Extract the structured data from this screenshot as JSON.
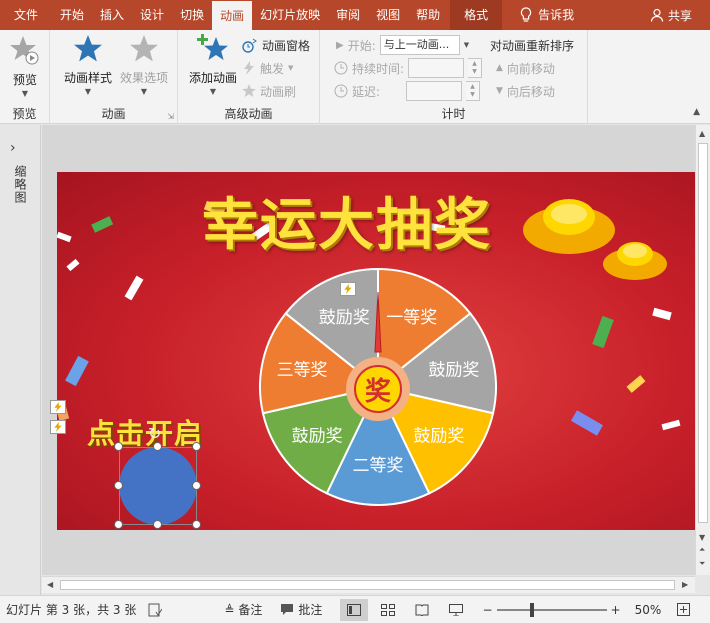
{
  "tabs": [
    {
      "label": "文件",
      "active": false
    },
    {
      "label": "开始",
      "active": false
    },
    {
      "label": "插入",
      "active": false
    },
    {
      "label": "设计",
      "active": false
    },
    {
      "label": "切换",
      "active": false
    },
    {
      "label": "动画",
      "active": true
    },
    {
      "label": "幻灯片放映",
      "active": false
    },
    {
      "label": "审阅",
      "active": false
    },
    {
      "label": "视图",
      "active": false
    },
    {
      "label": "帮助",
      "active": false
    }
  ],
  "context_tab": "格式",
  "tell_me": "告诉我",
  "share": "共享",
  "ribbon": {
    "preview": {
      "button": "预览",
      "group": "预览"
    },
    "animation": {
      "style_button": "动画样式",
      "effect_button": "效果选项",
      "group": "动画"
    },
    "advanced": {
      "add_button": "添加动画",
      "pane": "动画窗格",
      "trigger": "触发",
      "painter": "动画刷",
      "group": "高级动画"
    },
    "timing": {
      "start_label": "开始:",
      "start_value": "与上一动画...",
      "duration_label": "持续时间:",
      "duration_value": "",
      "delay_label": "延迟:",
      "delay_value": "",
      "reorder_title": "对动画重新排序",
      "move_earlier": "向前移动",
      "move_later": "向后移动",
      "group": "计时"
    }
  },
  "left_panel": {
    "label": "缩略图"
  },
  "slide": {
    "title": "幸运大抽奖",
    "button_text": "点击开启",
    "wheel_center": "奖",
    "wheel_segments": [
      "一等奖",
      "鼓励奖",
      "鼓励奖",
      "二等奖",
      "鼓励奖",
      "三等奖",
      "鼓励奖"
    ],
    "segment_colors": [
      "#ee7d31",
      "#a5a5a5",
      "#ffc000",
      "#5b9bd5",
      "#70ad47",
      "#ee7d31",
      "#a5a5a5"
    ]
  },
  "status": {
    "slide_info": "幻灯片 第 3 张，共 3 张",
    "notes": "备注",
    "comments": "批注",
    "zoom": "50%"
  }
}
